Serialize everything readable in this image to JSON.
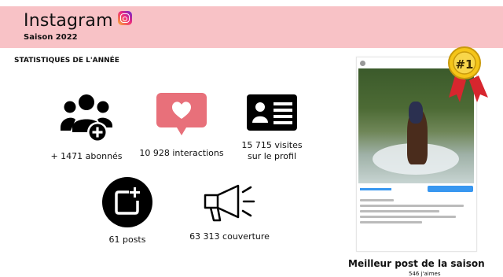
{
  "header": {
    "title": "Instagram",
    "subtitle": "Saison 2022",
    "bg_color": "#f8c2c6"
  },
  "section": {
    "title": "STATISTIQUES DE L'ANNÉE"
  },
  "stats": {
    "followers": {
      "label": "+ 1471 abonnés",
      "icon": "followers-add-icon"
    },
    "interactions": {
      "label": "10 928 interactions",
      "icon": "heart-bubble-icon",
      "color": "#e8707a"
    },
    "visits": {
      "line1": "15 715 visites",
      "line2": "sur le profil",
      "icon": "profile-card-icon"
    },
    "posts": {
      "label": "61 posts",
      "icon": "new-post-icon"
    },
    "reach": {
      "label": "63 313 couverture",
      "icon": "megaphone-icon"
    }
  },
  "best_post": {
    "label": "Meilleur post de la saison",
    "likes": "546 j'aimes",
    "rank": "#1"
  }
}
